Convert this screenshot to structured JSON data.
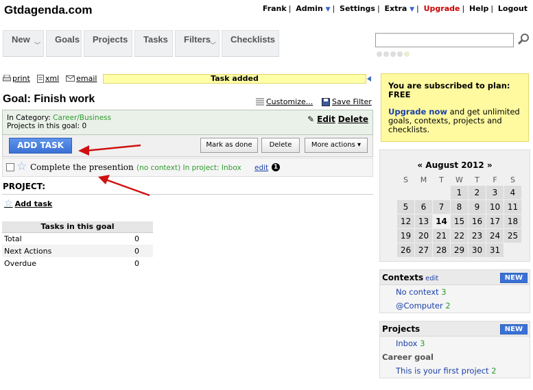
{
  "header": {
    "logo": "Gtdagenda.com",
    "nav": {
      "user": "Frank",
      "admin": "Admin",
      "settings": "Settings",
      "extra": "Extra",
      "upgrade": "Upgrade",
      "help": "Help",
      "logout": "Logout",
      "dropdown_arrow": "▼"
    }
  },
  "tabs": [
    {
      "label": "New"
    },
    {
      "label": "Goals"
    },
    {
      "label": "Projects"
    },
    {
      "label": "Tasks"
    },
    {
      "label": "Filters"
    },
    {
      "label": "Checklists"
    }
  ],
  "search": {
    "value": "",
    "placeholder": ""
  },
  "toolbar": {
    "print": "print",
    "xml": "xml",
    "email": "email"
  },
  "notice": "Task added",
  "goal": {
    "title": "Goal: Finish work",
    "customize": "Customize...",
    "save_filter": "Save Filter",
    "category_label": "In Category:",
    "category": "Career/Business",
    "projects_label": "Projects in this goal: 0",
    "edit": "Edit",
    "delete": "Delete"
  },
  "actions": {
    "add_task": "ADD TASK",
    "mark_done": "Mark as done",
    "delete": "Delete",
    "more": "More actions ▾"
  },
  "task": {
    "name": "Complete the presention",
    "context": "(no context) In project: Inbox",
    "edit": "edit",
    "badge": "1"
  },
  "project_heading": "PROJECT:",
  "add_task_link": "Add task",
  "stats": {
    "title": "Tasks in this goal",
    "rows": [
      {
        "label": "Total",
        "value": "0"
      },
      {
        "label": "Next Actions",
        "value": "0"
      },
      {
        "label": "Overdue",
        "value": "0"
      }
    ]
  },
  "subscription": {
    "line1": "You are subscribed to plan: FREE",
    "upgrade": "Upgrade now",
    "rest": " and get unlimited goals, contexts, projects and checklists."
  },
  "calendar": {
    "title": "« August 2012 »",
    "dow": [
      "S",
      "M",
      "T",
      "W",
      "T",
      "F",
      "S"
    ],
    "weeks": [
      [
        "",
        "",
        "",
        "1",
        "2",
        "3",
        "4"
      ],
      [
        "5",
        "6",
        "7",
        "8",
        "9",
        "10",
        "11"
      ],
      [
        "12",
        "13",
        "14",
        "15",
        "16",
        "17",
        "18"
      ],
      [
        "19",
        "20",
        "21",
        "22",
        "23",
        "24",
        "25"
      ],
      [
        "26",
        "27",
        "28",
        "29",
        "30",
        "31",
        ""
      ]
    ],
    "today": "14"
  },
  "contexts": {
    "title": "Contexts",
    "edit": "edit",
    "new": "NEW",
    "items": [
      {
        "label": "No context",
        "count": "3"
      },
      {
        "label": "@Computer",
        "count": "2"
      }
    ]
  },
  "projects": {
    "title": "Projects",
    "new": "NEW",
    "inbox": {
      "label": "Inbox",
      "count": "3"
    },
    "group": "Career goal",
    "first": {
      "label": "This is your first project",
      "count": "2"
    }
  },
  "colors": {
    "accent": "#3b71d6",
    "notice_bg": "#ffffa8",
    "context_green": "#2f9a2f",
    "upgrade_red": "#cc0000"
  }
}
